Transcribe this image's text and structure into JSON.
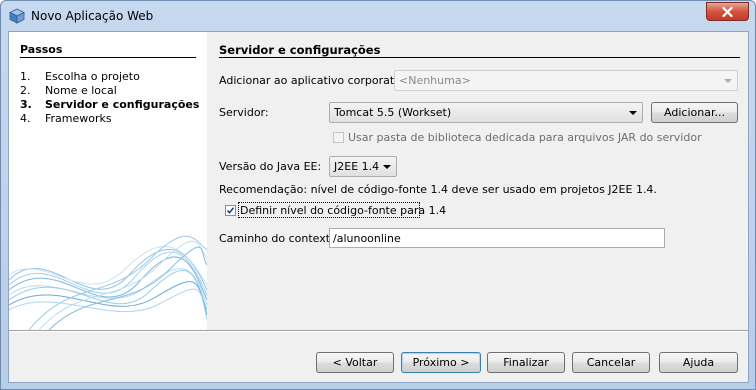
{
  "window": {
    "title": "Novo Aplicação Web",
    "icon": "netbeans-cube-icon"
  },
  "steps": {
    "title": "Passos",
    "items": [
      {
        "num": "1.",
        "label": "Escolha o projeto",
        "current": false
      },
      {
        "num": "2.",
        "label": "Nome e local",
        "current": false
      },
      {
        "num": "3.",
        "label": "Servidor e configurações",
        "current": true
      },
      {
        "num": "4.",
        "label": "Frameworks",
        "current": false
      }
    ]
  },
  "content": {
    "title": "Servidor e configurações",
    "enterprise_app_label": "Adicionar ao aplicativo corporativo:",
    "enterprise_app_value": "<Nenhuma>",
    "server_label": "Servidor:",
    "server_value": "Tomcat 5.5 (Workset)",
    "add_server_button": "Adicionar...",
    "dedicated_lib_checkbox": "Usar pasta de biblioteca dedicada para arquivos JAR do servidor",
    "java_ee_label": "Versão do Java EE:",
    "java_ee_value": "J2EE 1.4",
    "recommendation": "Recomendação: nível de código-fonte 1.4 deve ser usado em projetos J2EE 1.4.",
    "source_level_checkbox": "Definir nível do código-fonte para 1.4",
    "source_level_checked": true,
    "context_path_label": "Caminho do contexto:",
    "context_path_value": "/alunoonline"
  },
  "buttons": {
    "back": "< Voltar",
    "next": "Próximo >",
    "finish": "Finalizar",
    "cancel": "Cancelar",
    "help": "Ajuda"
  },
  "colors": {
    "title_bar": "#c6d9ee",
    "close_button": "#c23b25",
    "dialog_background": "#f0f0f0",
    "default_button_border": "#3c7fb1"
  }
}
